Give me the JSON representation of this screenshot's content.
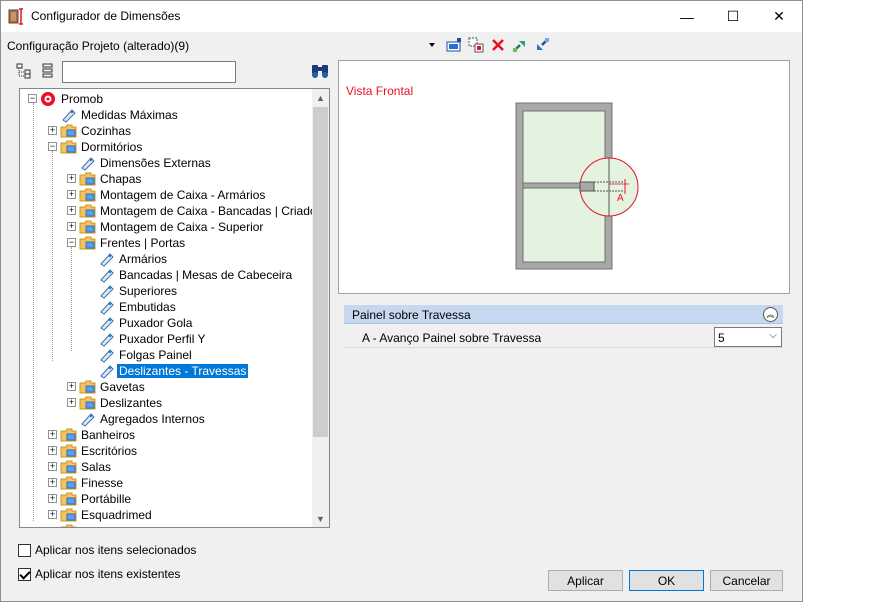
{
  "window": {
    "title": "Configurador de Dimensões",
    "controls": {
      "minimize": "—",
      "maximize": "☐",
      "close": "✕"
    }
  },
  "config_label": "Configuração Projeto (alterado)(9)",
  "toolbar": {
    "icons": [
      "dropdown-arrow-icon",
      "add-config-icon",
      "copy-config-icon",
      "delete-icon",
      "export-icon",
      "import-icon"
    ]
  },
  "search": {
    "value": "",
    "placeholder": ""
  },
  "tree": {
    "root": "Promob",
    "items": [
      {
        "label": "Medidas Máximas",
        "level": 1,
        "type": "leaf"
      },
      {
        "label": "Cozinhas",
        "level": 1,
        "type": "folder",
        "expanded": false
      },
      {
        "label": "Dormitórios",
        "level": 1,
        "type": "folder",
        "expanded": true
      },
      {
        "label": "Dimensões Externas",
        "level": 2,
        "type": "leaf"
      },
      {
        "label": "Chapas",
        "level": 2,
        "type": "folder",
        "expanded": false
      },
      {
        "label": "Montagem de Caixa - Armários",
        "level": 2,
        "type": "folder",
        "expanded": false
      },
      {
        "label": "Montagem de Caixa - Bancadas | Criados",
        "level": 2,
        "type": "folder",
        "expanded": false
      },
      {
        "label": "Montagem de Caixa - Superior",
        "level": 2,
        "type": "folder",
        "expanded": false
      },
      {
        "label": "Frentes | Portas",
        "level": 2,
        "type": "folder",
        "expanded": true
      },
      {
        "label": "Armários",
        "level": 3,
        "type": "leaf"
      },
      {
        "label": "Bancadas |  Mesas de Cabeceira",
        "level": 3,
        "type": "leaf"
      },
      {
        "label": "Superiores",
        "level": 3,
        "type": "leaf"
      },
      {
        "label": "Embutidas",
        "level": 3,
        "type": "leaf"
      },
      {
        "label": "Puxador Gola",
        "level": 3,
        "type": "leaf"
      },
      {
        "label": "Puxador Perfil Y",
        "level": 3,
        "type": "leaf"
      },
      {
        "label": "Folgas Painel",
        "level": 3,
        "type": "leaf"
      },
      {
        "label": "Deslizantes - Travessas",
        "level": 3,
        "type": "leaf",
        "selected": true
      },
      {
        "label": "Gavetas",
        "level": 2,
        "type": "folder",
        "expanded": false
      },
      {
        "label": "Deslizantes",
        "level": 2,
        "type": "folder",
        "expanded": false
      },
      {
        "label": "Agregados Internos",
        "level": 2,
        "type": "leaf"
      },
      {
        "label": "Banheiros",
        "level": 1,
        "type": "folder",
        "expanded": false
      },
      {
        "label": "Escritórios",
        "level": 1,
        "type": "folder",
        "expanded": false
      },
      {
        "label": "Salas",
        "level": 1,
        "type": "folder",
        "expanded": false
      },
      {
        "label": "Finesse",
        "level": 1,
        "type": "folder",
        "expanded": false
      },
      {
        "label": "Portábille",
        "level": 1,
        "type": "folder",
        "expanded": false
      },
      {
        "label": "Esquadrimed",
        "level": 1,
        "type": "folder",
        "expanded": false
      }
    ]
  },
  "checkboxes": [
    {
      "label": "Aplicar nos itens selecionados",
      "checked": false
    },
    {
      "label": "Aplicar nos itens existentes",
      "checked": true
    }
  ],
  "preview": {
    "title": "Vista Frontal",
    "marker": "A"
  },
  "properties": {
    "group_title": "Painel sobre Travessa",
    "rows": [
      {
        "label": "A - Avanço Painel sobre Travessa",
        "value": "5"
      }
    ]
  },
  "buttons": {
    "apply": "Aplicar",
    "ok": "OK",
    "cancel": "Cancelar"
  },
  "colors": {
    "accent": "#0078d7",
    "preview_title": "#e81123",
    "group_header": "#c5d8f0",
    "panel_green": "#e3f3e0"
  }
}
